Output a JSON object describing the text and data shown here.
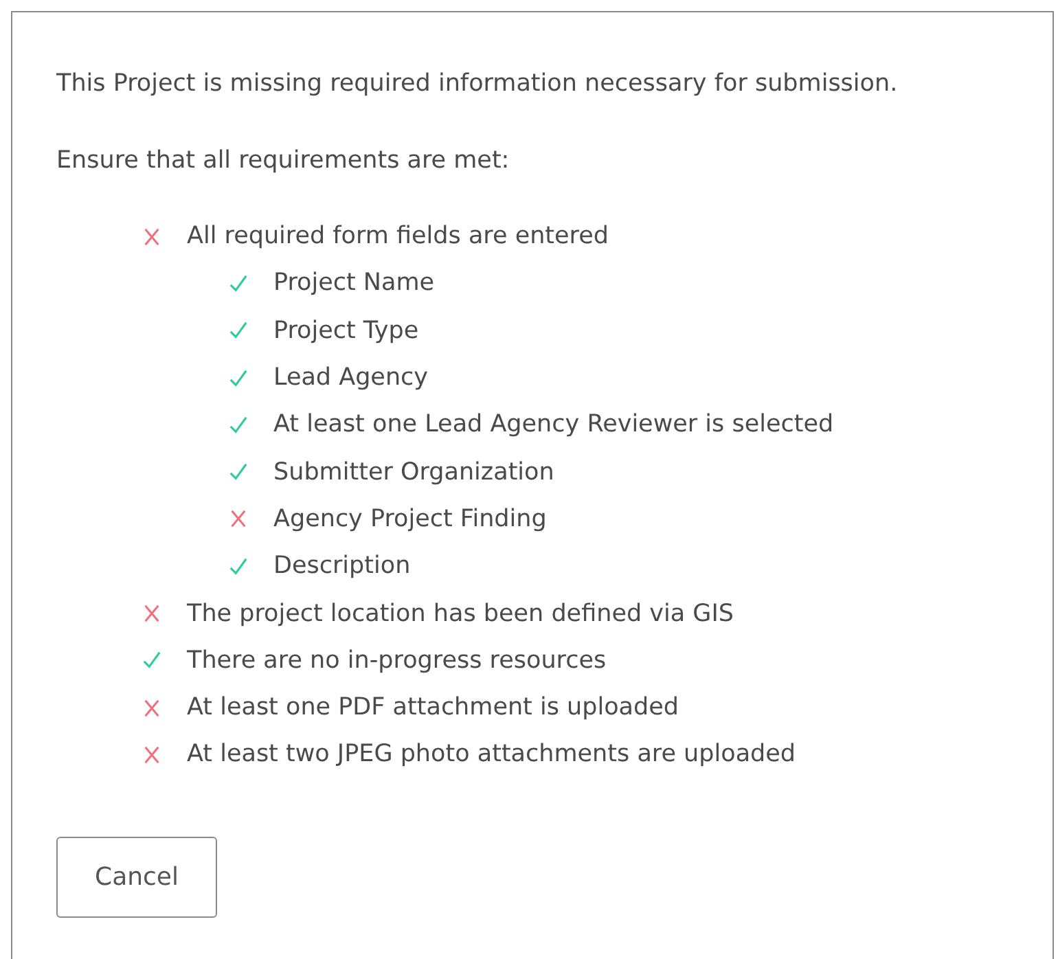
{
  "message": "This Project is missing required information necessary for submission.",
  "instruction": "Ensure that all requirements are met:",
  "requirements": [
    {
      "label": "All required form fields are entered",
      "met": false,
      "children": [
        {
          "label": "Project Name",
          "met": true
        },
        {
          "label": "Project Type",
          "met": true
        },
        {
          "label": "Lead Agency",
          "met": true
        },
        {
          "label": "At least one Lead Agency Reviewer is selected",
          "met": true
        },
        {
          "label": "Submitter Organization",
          "met": true
        },
        {
          "label": "Agency Project Finding",
          "met": false
        },
        {
          "label": "Description",
          "met": true
        }
      ]
    },
    {
      "label": "The project location has been defined via GIS",
      "met": false
    },
    {
      "label": "There are no in-progress resources",
      "met": true
    },
    {
      "label": "At least one PDF attachment is uploaded",
      "met": false
    },
    {
      "label": "At least two JPEG photo attachments are uploaded",
      "met": false
    }
  ],
  "buttons": [
    "Cancel"
  ]
}
